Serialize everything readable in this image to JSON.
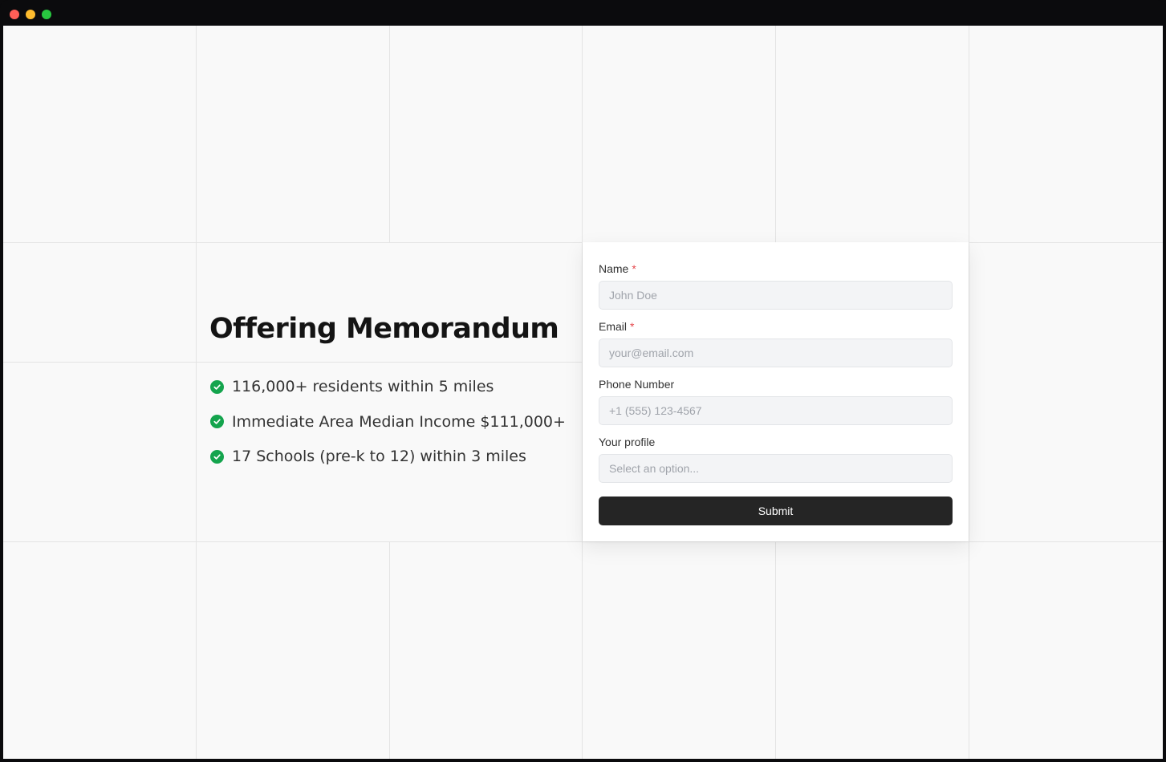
{
  "hero": {
    "title": "Offering Memorandum",
    "features": [
      "116,000+ residents within 5 miles",
      "Immediate Area Median Income $111,000+",
      "17 Schools (pre-k to 12) within 3 miles"
    ]
  },
  "form": {
    "name": {
      "label": "Name",
      "required_mark": "*",
      "placeholder": "John Doe"
    },
    "email": {
      "label": "Email",
      "required_mark": "*",
      "placeholder": "your@email.com"
    },
    "phone": {
      "label": "Phone Number",
      "placeholder": "+1 (555) 123-4567"
    },
    "profile": {
      "label": "Your profile",
      "placeholder": "Select an option..."
    },
    "submit_label": "Submit"
  },
  "colors": {
    "check": "#14a44d",
    "required": "#e5484d",
    "button": "#252525",
    "background": "#f9f9f9"
  }
}
